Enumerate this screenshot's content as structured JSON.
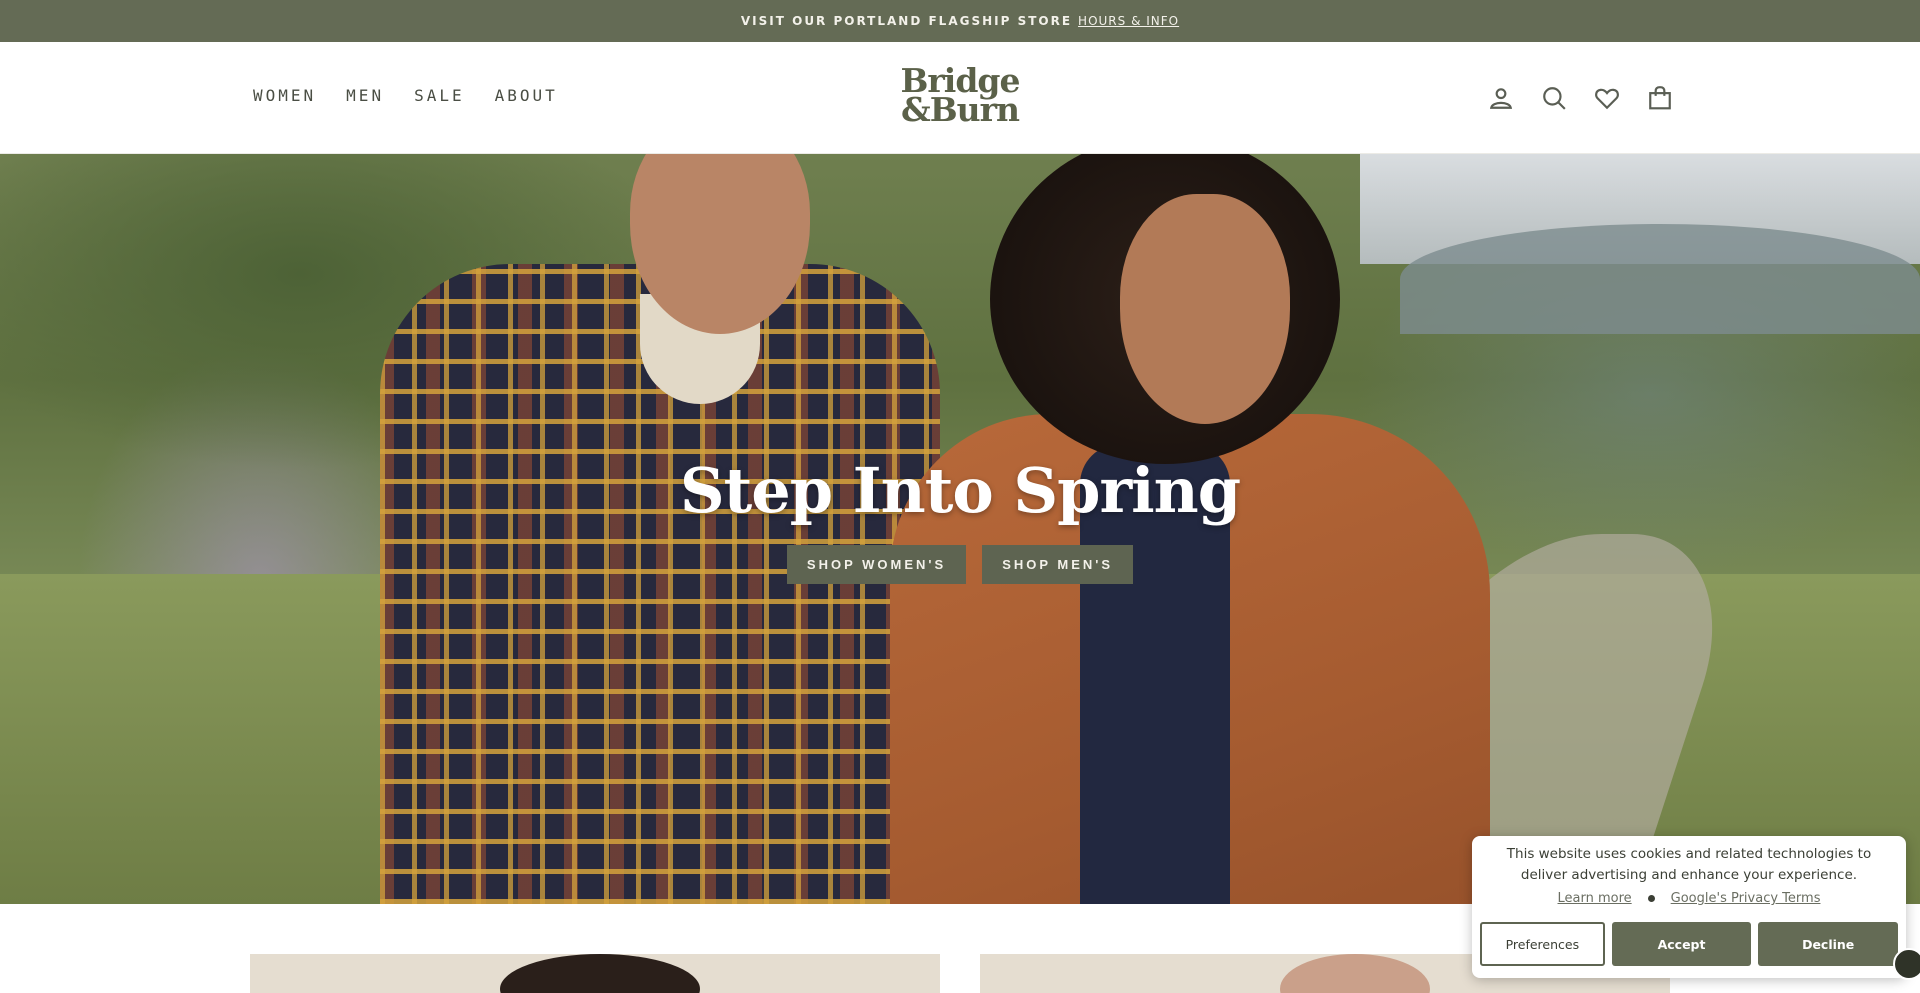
{
  "announcement": {
    "text": "VISIT OUR PORTLAND FLAGSHIP STORE",
    "link": "HOURS & INFO"
  },
  "nav": {
    "items": [
      "WOMEN",
      "MEN",
      "SALE",
      "ABOUT"
    ]
  },
  "logo": {
    "line1": "Bridge",
    "line2": "&Burn"
  },
  "header_icons": [
    "account-icon",
    "search-icon",
    "wishlist-heart-icon",
    "cart-bag-icon"
  ],
  "hero": {
    "title": "Step Into Spring",
    "buttons": [
      "SHOP WOMEN'S",
      "SHOP MEN'S"
    ]
  },
  "cookie_banner": {
    "text": "This website uses cookies and related technologies to deliver advertising and enhance your experience.",
    "learn_more": "Learn more",
    "privacy": "Google's Privacy Terms",
    "preferences": "Preferences",
    "accept": "Accept",
    "decline": "Decline"
  },
  "colors": {
    "brand_green": "#646b55",
    "button_green": "#5e6451",
    "logo_green": "#5b6149"
  }
}
